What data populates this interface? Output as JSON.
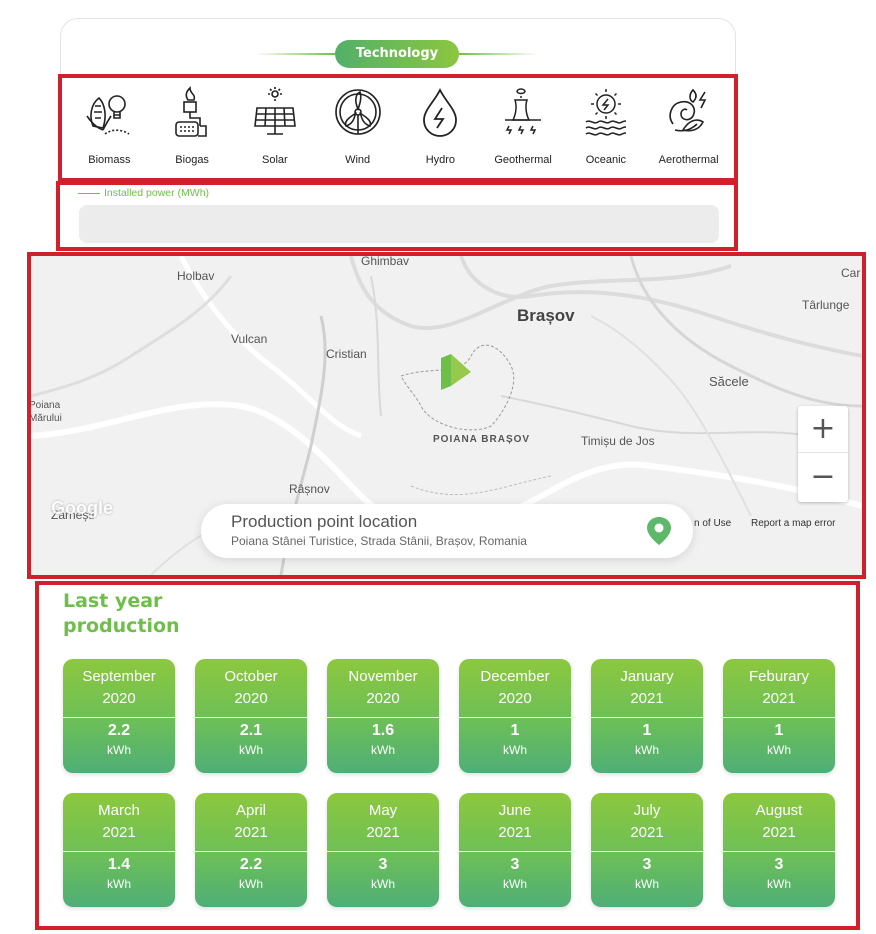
{
  "technology": {
    "title": "Technology",
    "items": [
      {
        "label": "Biomass",
        "icon": "biomass-icon"
      },
      {
        "label": "Biogas",
        "icon": "biogas-icon"
      },
      {
        "label": "Solar",
        "icon": "solar-panel-icon"
      },
      {
        "label": "Wind",
        "icon": "wind-turbine-icon"
      },
      {
        "label": "Hydro",
        "icon": "water-drop-icon"
      },
      {
        "label": "Geothermal",
        "icon": "geothermal-plant-icon"
      },
      {
        "label": "Oceanic",
        "icon": "oceanic-icon"
      },
      {
        "label": "Aerothermal",
        "icon": "aerothermal-icon"
      }
    ]
  },
  "installed_power": {
    "label": "Installed power (MWh)",
    "value": ""
  },
  "map": {
    "places": {
      "holbav": "Holbav",
      "ghimbav": "Ghimbav",
      "car": "Car",
      "tarlungeni": "Târlunge",
      "brasov": "Brașov",
      "vulcan": "Vulcan",
      "cristian": "Cristian",
      "sacele": "Săcele",
      "poiana": "Poiana",
      "marului": "Mărului",
      "poiana_brasov": "POIANA BRAȘOV",
      "timisu": "Timișu de Jos",
      "rasnov": "Râșnov",
      "zarnesti": "Zărnești"
    },
    "zoom_in": "+",
    "zoom_out": "−",
    "google": "Google",
    "terms": "n of Use",
    "report": "Report a map error",
    "accent": "#6dbf4a"
  },
  "location": {
    "title": "Production point location",
    "address": "Poiana Stânei Turistice, Strada Stânii, Brașov, Romania"
  },
  "production": {
    "title": "Last year production",
    "months": [
      {
        "month": "September",
        "year": "2020",
        "value": "2.2",
        "unit": "kWh"
      },
      {
        "month": "October",
        "year": "2020",
        "value": "2.1",
        "unit": "kWh"
      },
      {
        "month": "November",
        "year": "2020",
        "value": "1.6",
        "unit": "kWh"
      },
      {
        "month": "December",
        "year": "2020",
        "value": "1",
        "unit": "kWh"
      },
      {
        "month": "January",
        "year": "2021",
        "value": "1",
        "unit": "kWh"
      },
      {
        "month": "Feburary",
        "year": "2021",
        "value": "1",
        "unit": "kWh"
      },
      {
        "month": "March",
        "year": "2021",
        "value": "1.4",
        "unit": "kWh"
      },
      {
        "month": "April",
        "year": "2021",
        "value": "2.2",
        "unit": "kWh"
      },
      {
        "month": "May",
        "year": "2021",
        "value": "3",
        "unit": "kWh"
      },
      {
        "month": "June",
        "year": "2021",
        "value": "3",
        "unit": "kWh"
      },
      {
        "month": "July",
        "year": "2021",
        "value": "3",
        "unit": "kWh"
      },
      {
        "month": "August",
        "year": "2021",
        "value": "3",
        "unit": "kWh"
      }
    ]
  },
  "colors": {
    "highlight_border": "#d0202b",
    "brand_green": "#6dbf4a",
    "card_gradient_top": "#8cc83e",
    "card_gradient_bottom": "#4fae77"
  }
}
